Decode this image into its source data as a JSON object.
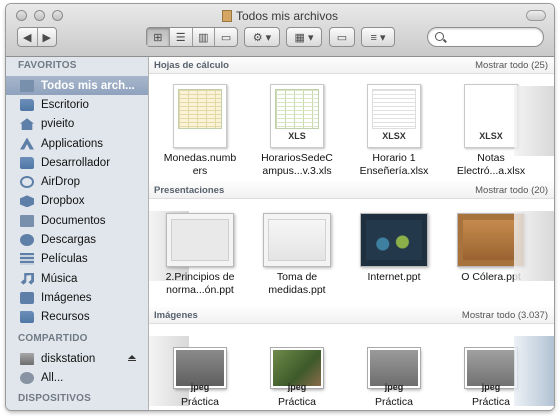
{
  "window": {
    "title": "Todos mis archivos"
  },
  "sidebar": {
    "favorites_header": "FAVORITOS",
    "favorites": [
      {
        "label": "Todos mis arch...",
        "icon": "all-files-icon",
        "selected": true
      },
      {
        "label": "Escritorio",
        "icon": "desktop-folder-icon"
      },
      {
        "label": "pvieito",
        "icon": "home-icon"
      },
      {
        "label": "Applications",
        "icon": "applications-icon"
      },
      {
        "label": "Desarrollador",
        "icon": "folder-icon"
      },
      {
        "label": "AirDrop",
        "icon": "airdrop-icon"
      },
      {
        "label": "Dropbox",
        "icon": "dropbox-icon"
      },
      {
        "label": "Documentos",
        "icon": "documents-icon"
      },
      {
        "label": "Descargas",
        "icon": "downloads-icon"
      },
      {
        "label": "Películas",
        "icon": "movies-icon"
      },
      {
        "label": "Música",
        "icon": "music-icon"
      },
      {
        "label": "Imágenes",
        "icon": "pictures-icon"
      },
      {
        "label": "Recursos",
        "icon": "folder-icon"
      }
    ],
    "shared_header": "COMPARTIDO",
    "shared": [
      {
        "label": "diskstation",
        "icon": "network-drive-icon"
      },
      {
        "label": "All...",
        "icon": "network-globe-icon"
      }
    ],
    "devices_header": "DISPOSITIVOS"
  },
  "sections": {
    "spreadsheets": {
      "title": "Hojas de cálculo",
      "show_all": "Mostrar todo (25)",
      "items": [
        {
          "label_line1": "Monedas.numb",
          "label_line2": "ers",
          "ext": ""
        },
        {
          "label_line1": "HorariosSedeC",
          "label_line2": "ampus...v.3.xls",
          "ext": "XLS"
        },
        {
          "label_line1": "Horario 1",
          "label_line2": "Enseñería.xlsx",
          "ext": "XLSX"
        },
        {
          "label_line1": "Notas",
          "label_line2": "Electró...a.xlsx",
          "ext": "XLSX"
        }
      ]
    },
    "presentations": {
      "title": "Presentaciones",
      "show_all": "Mostrar todo (20)",
      "items": [
        {
          "label_line1": "2.Principios de",
          "label_line2": "norma...ón.ppt"
        },
        {
          "label_line1": "Toma de",
          "label_line2": "medidas.ppt"
        },
        {
          "label_line1": "Internet.ppt",
          "label_line2": ""
        },
        {
          "label_line1": "O Cólera.ppt",
          "label_line2": ""
        }
      ]
    },
    "images": {
      "title": "Imágenes",
      "show_all": "Mostrar todo (3.037)",
      "items": [
        {
          "label_line1": "Práctica",
          "ext": "jpeg"
        },
        {
          "label_line1": "Práctica",
          "ext": "jpeg"
        },
        {
          "label_line1": "Práctica",
          "ext": "jpeg"
        },
        {
          "label_line1": "Práctica",
          "ext": "jpeg"
        }
      ]
    }
  }
}
